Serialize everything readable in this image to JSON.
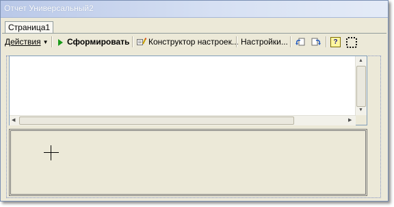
{
  "window": {
    "title": "Отчет  Универсальный2"
  },
  "tabs": [
    {
      "label": "Страница1"
    }
  ],
  "toolbar": {
    "actions_label": "Действия",
    "generate_label": "Сформировать",
    "constructor_label": "Конструктор настроек...",
    "settings_label": "Настройки...",
    "help_glyph": "?"
  },
  "colors": {
    "play_icon": "#1a9a1a",
    "window_bg": "#ece9d8",
    "titlebar": "#d6e0f3"
  },
  "icons": [
    "dropdown-arrow-icon",
    "play-icon",
    "settings-constructor-icon",
    "restore-settings-icon",
    "save-settings-icon",
    "help-icon",
    "select-area-icon",
    "crosshair-icon"
  ]
}
